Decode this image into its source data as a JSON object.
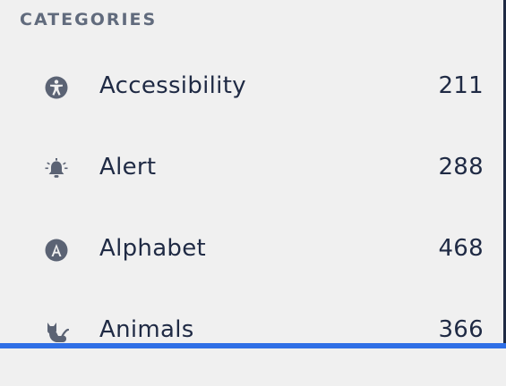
{
  "sidebar": {
    "heading": "CATEGORIES",
    "categories": [
      {
        "label": "Accessibility",
        "count": "211",
        "icon": "accessibility-icon"
      },
      {
        "label": "Alert",
        "count": "288",
        "icon": "bell-icon"
      },
      {
        "label": "Alphabet",
        "count": "468",
        "icon": "letter-a-icon"
      },
      {
        "label": "Animals",
        "count": "366",
        "icon": "cat-icon"
      }
    ]
  },
  "colors": {
    "background": "#f0f0f0",
    "text": "#1f2a44",
    "heading": "#616b7d",
    "icon": "#5b6374",
    "accent_bar": "#2f6fe6"
  }
}
